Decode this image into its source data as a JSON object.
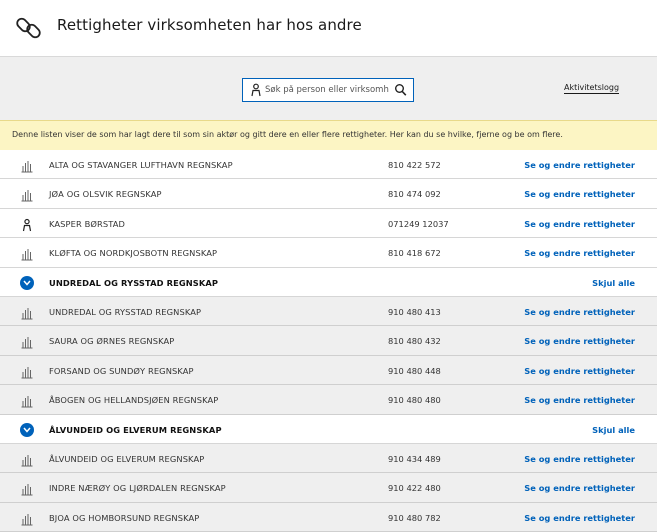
{
  "header": {
    "title": "Rettigheter virksomheten har hos andre",
    "icon": "link-icon"
  },
  "search": {
    "placeholder": "Søk på person eller virksomhet",
    "value": ""
  },
  "activity_log": "Aktivitetslogg",
  "info": "Denne listen viser de som har lagt dere til som sin aktør og gitt dere en eller flere rettigheter. Her kan du se hvilke, fjerne og be om flere.",
  "colors": {
    "accent": "#0062ba",
    "banner": "#fcf5c4",
    "subrow": "#efefef"
  },
  "rows": [
    {
      "kind": "org",
      "icon": "building-icon",
      "name": "ALTA OG STAVANGER LUFTHAVN REGNSKAP",
      "number": "810 422 572",
      "action": "Se og endre rettigheter"
    },
    {
      "kind": "org",
      "icon": "building-icon",
      "name": "JØA OG OLSVIK REGNSKAP",
      "number": "810 474 092",
      "action": "Se og endre rettigheter"
    },
    {
      "kind": "person",
      "icon": "person-icon",
      "name": "KASPER BØRSTAD",
      "number": "071249 12037",
      "action": "Se og endre rettigheter"
    },
    {
      "kind": "org",
      "icon": "building-icon",
      "name": "KLØFTA OG NORDKJOSBOTN REGNSKAP",
      "number": "810 418 672",
      "action": "Se og endre rettigheter"
    },
    {
      "kind": "group",
      "icon": "chevron-down-icon",
      "name": "UNDREDAL OG RYSSTAD REGNSKAP",
      "number": "",
      "action": "Skjul alle"
    },
    {
      "kind": "sub",
      "icon": "building-icon",
      "name": "UNDREDAL OG RYSSTAD REGNSKAP",
      "number": "910 480 413",
      "action": "Se og endre rettigheter"
    },
    {
      "kind": "sub",
      "icon": "building-icon",
      "name": "SAURA OG ØRNES REGNSKAP",
      "number": "810 480 432",
      "action": "Se og endre rettigheter"
    },
    {
      "kind": "sub",
      "icon": "building-icon",
      "name": "FORSAND OG SUNDØY REGNSKAP",
      "number": "910 480 448",
      "action": "Se og endre rettigheter"
    },
    {
      "kind": "sub",
      "icon": "building-icon",
      "name": "ÅBOGEN OG HELLANDSJØEN REGNSKAP",
      "number": "910 480 480",
      "action": "Se og endre rettigheter"
    },
    {
      "kind": "group",
      "icon": "chevron-down-icon",
      "name": "ÅLVUNDEID OG ELVERUM REGNSKAP",
      "number": "",
      "action": "Skjul alle"
    },
    {
      "kind": "sub",
      "icon": "building-icon",
      "name": "ÅLVUNDEID OG ELVERUM REGNSKAP",
      "number": "910 434 489",
      "action": "Se og endre rettigheter"
    },
    {
      "kind": "sub",
      "icon": "building-icon",
      "name": "INDRE NÆRØY OG LJØRDALEN REGNSKAP",
      "number": "910 422 480",
      "action": "Se og endre rettigheter"
    },
    {
      "kind": "sub",
      "icon": "building-icon",
      "name": "BJOA OG HOMBORSUND REGNSKAP",
      "number": "910 480 782",
      "action": "Se og endre rettigheter"
    }
  ]
}
